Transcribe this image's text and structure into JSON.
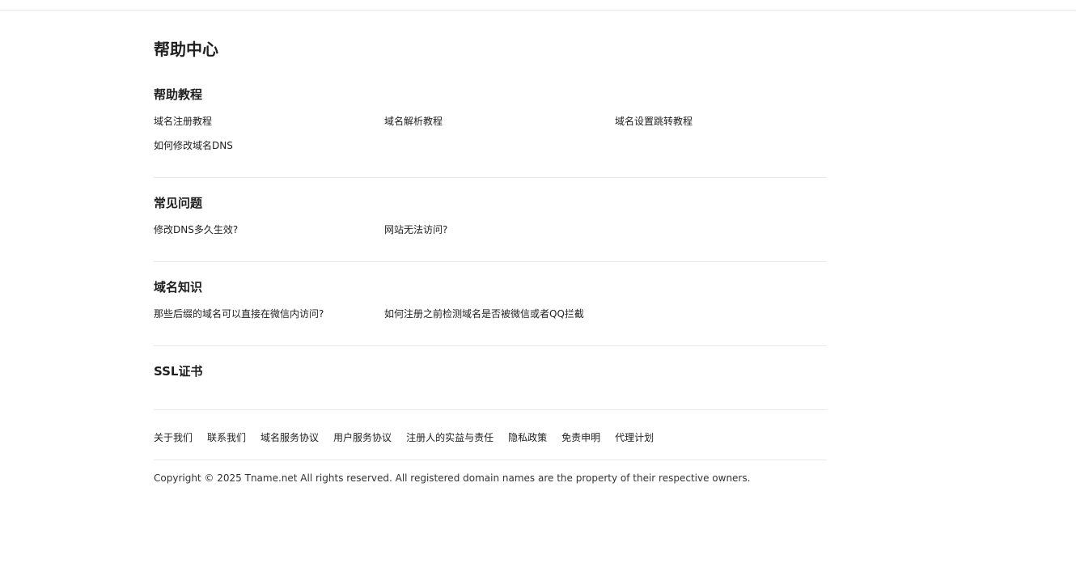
{
  "page": {
    "title": "帮助中心"
  },
  "sections": [
    {
      "title": "帮助教程",
      "links": [
        "域名注册教程",
        "域名解析教程",
        "域名设置跳转教程",
        "如何修改域名DNS"
      ]
    },
    {
      "title": "常见问题",
      "links": [
        "修改DNS多久生效?",
        "网站无法访问?"
      ]
    },
    {
      "title": "域名知识",
      "links": [
        "那些后缀的域名可以直接在微信内访问?",
        "如何注册之前检测域名是否被微信或者QQ拦截"
      ]
    },
    {
      "title": "SSL证书",
      "links": []
    }
  ],
  "footer": {
    "links": [
      "关于我们",
      "联系我们",
      "域名服务协议",
      "用户服务协议",
      "注册人的实益与责任",
      "隐私政策",
      "免责申明",
      "代理计划"
    ],
    "copyright": "Copyright © 2025 Tname.net All rights reserved. All registered domain names are the property of their respective owners."
  }
}
